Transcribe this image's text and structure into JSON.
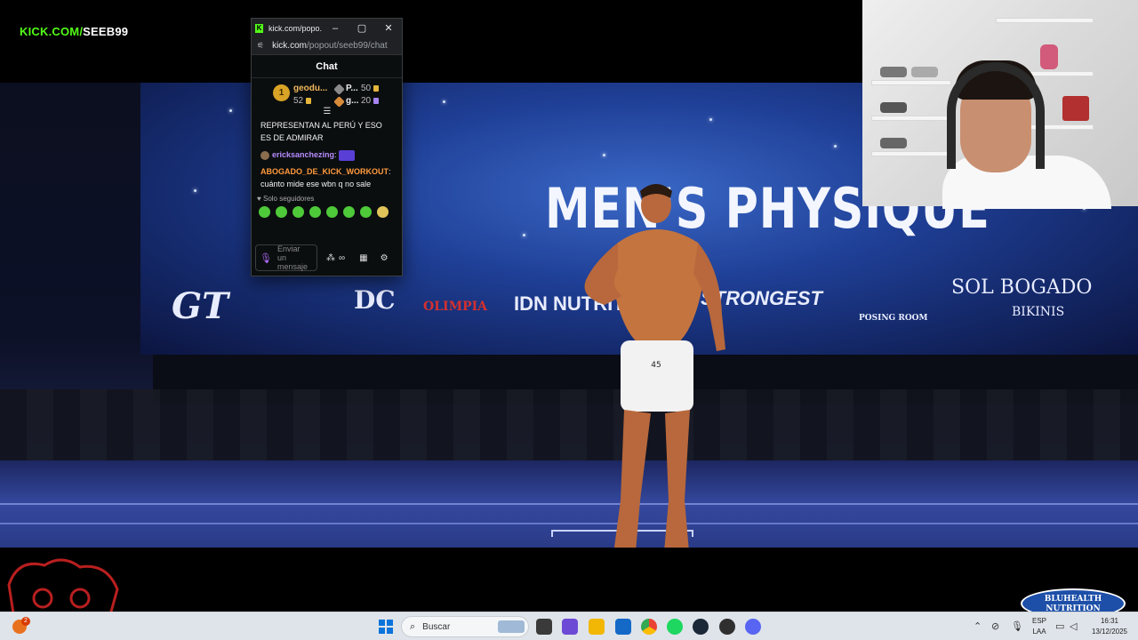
{
  "brand": {
    "kick": "KICK.COM/",
    "channel": "SEEB99"
  },
  "stage": {
    "headline": "MEN'S PHYSIQUE",
    "sponsors": [
      "GT",
      "DC",
      "OLIMPIA",
      "IDN NUTRITION",
      "STRONGEST",
      "POSING ROOM",
      "SOL BOGADO",
      "BIKINIS"
    ],
    "athlete_number": "45"
  },
  "chat_window": {
    "title": "kick.com/popo...",
    "url_domain": "kick.com",
    "url_path": "/popout/seeb99/chat",
    "header": "Chat",
    "leaderboard": [
      {
        "rank": "1",
        "name": "geodu...",
        "amount": "52"
      },
      {
        "name": "P...",
        "amount": "50"
      },
      {
        "name": "g...",
        "amount": "20"
      }
    ],
    "messages": [
      {
        "text": "REPRESENTAN AL PERÚ Y ESO ES DE ADMIRAR"
      },
      {
        "user": "ericksanchezing",
        "text": ""
      },
      {
        "user": "ABOGADO_DE_KICK_WORKOUT",
        "text": "cuánto mide ese wbn q no sale"
      }
    ],
    "followers_only": "Solo seguidores",
    "input_placeholder": "Enviar un mensaje"
  },
  "overlay": {
    "sponsor_badge_line1": "BLUHEALTH",
    "sponsor_badge_line2": "NUTRITION"
  },
  "taskbar": {
    "search_placeholder": "Buscar",
    "weather_badge": "2",
    "language_line1": "ESP",
    "language_line2": "LAA",
    "time": "16:31",
    "date": "13/12/2025"
  },
  "colors": {
    "kick_green": "#53fc18",
    "chat_bg": "#0b0e0f",
    "taskbar_bg": "#dfe4ea"
  }
}
